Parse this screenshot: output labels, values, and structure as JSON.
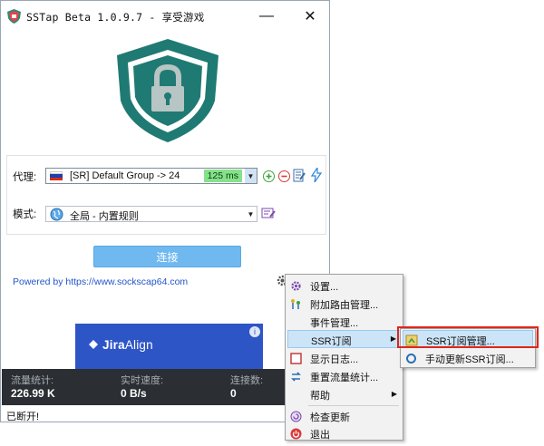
{
  "window": {
    "title": "SSTap Beta 1.0.9.7 - 享受游戏",
    "minimize_glyph": "—",
    "close_glyph": "✕"
  },
  "proxy": {
    "label": "代理:",
    "flag": "russia-flag",
    "value": "[SR] Default Group -> 24",
    "latency": "125 ms",
    "icons": [
      "add-icon",
      "remove-icon",
      "edit-icon",
      "lightning-icon"
    ]
  },
  "mode": {
    "label": "模式:",
    "value": "全局 - 内置规则",
    "icons": [
      "globe-icon",
      "edit-icon"
    ]
  },
  "connect_label": "连接",
  "powered_by": "Powered by https://www.sockscap64.com",
  "ad": {
    "brand_bold": "Jira",
    "brand_rest": "Align",
    "info_glyph": "i"
  },
  "stats": {
    "traffic_label": "流量统计:",
    "traffic_value": "226.99 K",
    "speed_label": "实时速度:",
    "speed_value": "0 B/s",
    "connections_label": "连接数:",
    "connections_value": "0"
  },
  "status_text": "已断开!",
  "context_menu": {
    "items": [
      {
        "label": "设置...",
        "icon": "gear-icon"
      },
      {
        "label": "附加路由管理...",
        "icon": "route-icon"
      },
      {
        "label": "事件管理...",
        "icon": "none"
      },
      {
        "label": "SSR订阅",
        "icon": "none",
        "highlighted": true,
        "submenu": true
      },
      {
        "label": "显示日志...",
        "icon": "log-icon"
      },
      {
        "label": "重置流量统计...",
        "icon": "refresh-icon"
      },
      {
        "label": "帮助",
        "icon": "none",
        "submenu": true
      },
      {
        "label": "检查更新",
        "icon": "update-icon"
      },
      {
        "label": "退出",
        "icon": "power-icon"
      }
    ],
    "submenu_arrow": "▶"
  },
  "submenu": {
    "items": [
      {
        "label": "SSR订阅管理...",
        "icon": "subscription-icon",
        "highlighted": true
      },
      {
        "label": "手动更新SSR订阅...",
        "icon": "sync-icon"
      }
    ]
  },
  "colors": {
    "shield": "#1f7a73",
    "connect_button": "#6fb8f0",
    "stats_bar": "#2b2f33",
    "menu_highlight": "#cce4f7",
    "annotation_box": "#e0261b",
    "latency_badge": "#86e28a"
  }
}
